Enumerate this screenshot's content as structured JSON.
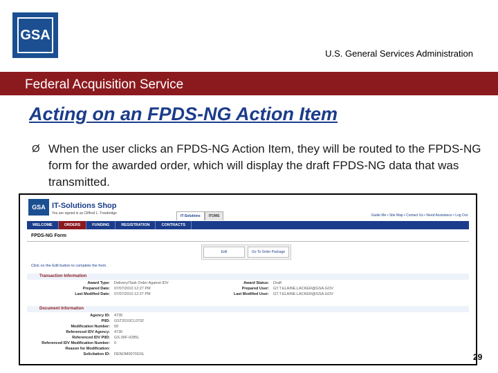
{
  "header": {
    "logo_text": "GSA",
    "agency": "U.S. General Services Administration",
    "service": "Federal Acquisition Service"
  },
  "slide": {
    "title": "Acting on an FPDS-NG Action Item",
    "bullet_mark": "Ø",
    "bullet": "When the user clicks an FPDS-NG Action Item, they will be routed to the FPDS-NG form for the awarded order, which  will display the draft FPDS-NG data that was transmitted.",
    "page_number": "29"
  },
  "screenshot": {
    "logo_text": "GSA",
    "shop_name": "IT-Solutions Shop",
    "signed_in": "You are signed in as Clifford L. Trowbridge",
    "top_tabs": [
      "IT-Solutions",
      "ITOMS"
    ],
    "util_links": "Guide Me • Site Map • Contact Us • Need Assistance • Log Out",
    "menu": [
      "WELCOME",
      "ORDERS",
      "FUNDING",
      "REGISTRATION",
      "CONTRACTS"
    ],
    "active_menu": "ORDERS",
    "form_title": "FPDS-NG Form",
    "buttons": {
      "edit": "Edit",
      "go_to_order": "Go To Order Package"
    },
    "hint": "Click on the Edit button to complete the form.",
    "sections": {
      "transaction": "Transaction Information",
      "document": "Document Information"
    },
    "transaction_left": [
      {
        "label": "Award Type:",
        "value": "Delivery/Task Order Against IDV"
      },
      {
        "label": "Prepared Date:",
        "value": "07/07/2010 12:27 PM"
      },
      {
        "label": "Last Modified Date:",
        "value": "07/07/2010 12:27 PM"
      }
    ],
    "transaction_right": [
      {
        "label": "Award Status:",
        "value": "Draft"
      },
      {
        "label": "Prepared User:",
        "value": "GT.T.ELAINE.LACKER@GSA.GOV"
      },
      {
        "label": "Last Modified User:",
        "value": "GT.T.ELAINE.LACKER@GSA.GOV"
      }
    ],
    "document_rows": [
      {
        "label": "Agency ID:",
        "value": "4735"
      },
      {
        "label": "PIID:",
        "value": "GST2010CL0702"
      },
      {
        "label": "Modification Number:",
        "value": "00"
      },
      {
        "label": "Referenced IDV Agency:",
        "value": "4730"
      },
      {
        "label": "Referenced IDV PIID:",
        "value": "GS-35F-0285L"
      },
      {
        "label": "Referenced IDV Modification Number:",
        "value": "0"
      },
      {
        "label": "Reason for Modification:",
        "value": ""
      },
      {
        "label": "Solicitation ID:",
        "value": "DENOM0070GSL"
      }
    ]
  },
  "colors": {
    "brand_blue": "#1b4f91",
    "title_blue": "#1b3c8b",
    "service_red": "#8b1a1f"
  }
}
